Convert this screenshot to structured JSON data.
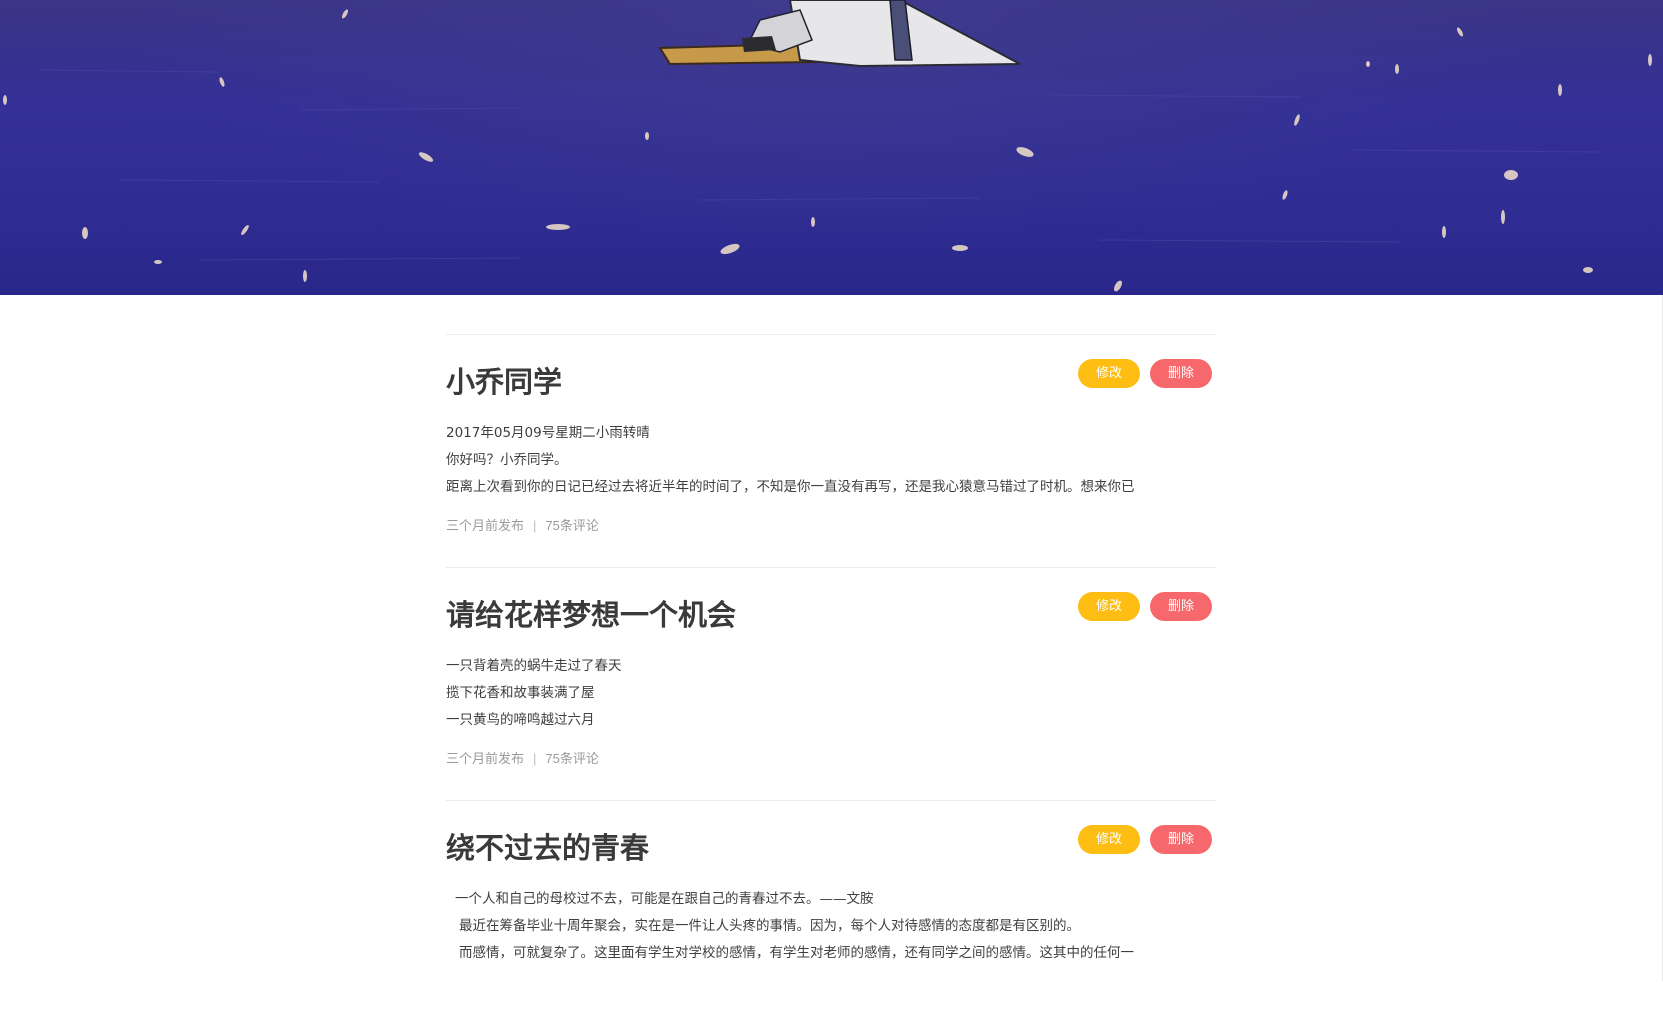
{
  "posts": [
    {
      "title": "小乔同学",
      "lines": [
        "2017年05月09号星期二小雨转晴",
        "你好吗？小乔同学。",
        "距离上次看到你的日记已经过去将近半年的时间了，不知是你一直没有再写，还是我心猿意马错过了时机。想来你已"
      ],
      "time": "三个月前发布",
      "comments": "75条评论",
      "edit_label": "修改",
      "delete_label": "删除"
    },
    {
      "title": "请给花样梦想一个机会",
      "lines": [
        "一只背着壳的蜗牛走过了春天",
        "揽下花香和故事装满了屋",
        "一只黄鸟的啼鸣越过六月"
      ],
      "time": "三个月前发布",
      "comments": "75条评论",
      "edit_label": "修改",
      "delete_label": "删除"
    },
    {
      "title": "绕不过去的青春",
      "lines": [
        "一个人和自己的母校过不去，可能是在跟自己的青春过不去。——文胺",
        "最近在筹备毕业十周年聚会，实在是一件让人头疼的事情。因为，每个人对待感情的态度都是有区别的。",
        "而感情，可就复杂了。这里面有学生对学校的感情，有学生对老师的感情，还有同学之间的感情。这其中的任何一"
      ],
      "edit_label": "修改",
      "delete_label": "删除"
    }
  ],
  "meta_separator": "|",
  "colors": {
    "edit": "#fdbd12",
    "delete": "#f6686c",
    "title": "#3a3a3a",
    "meta": "#9a9a9a",
    "hero_sea": "#2f2c93"
  }
}
